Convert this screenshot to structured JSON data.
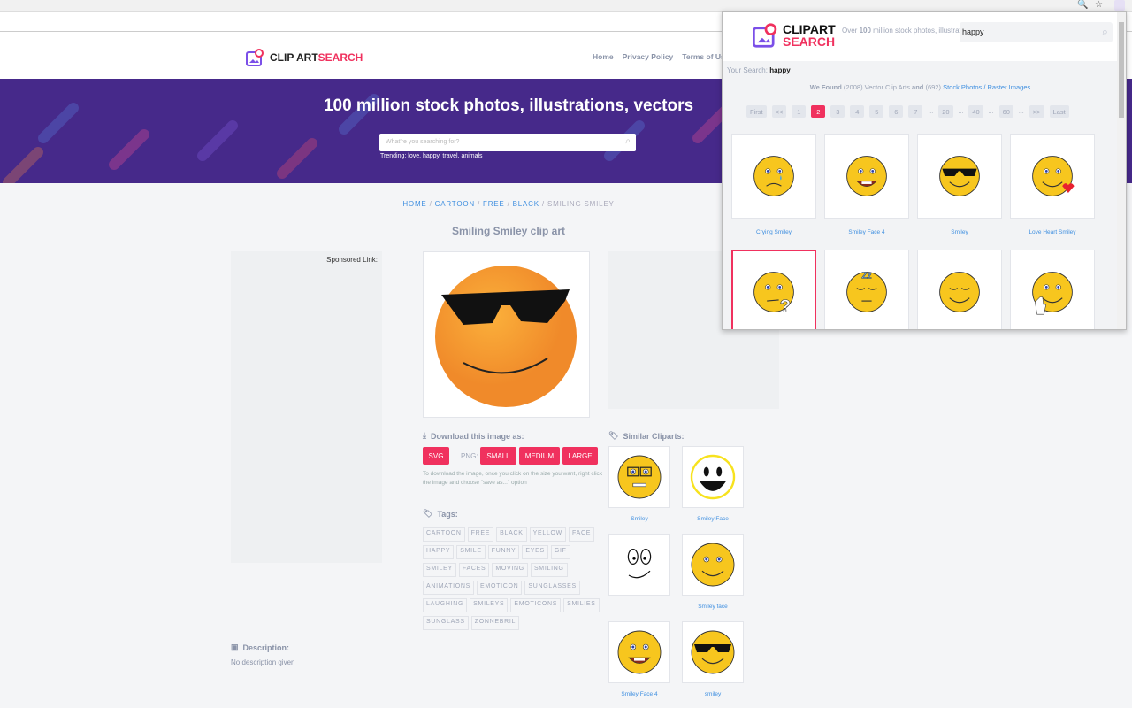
{
  "browser": {
    "icons": [
      "zoom-icon",
      "star-icon",
      "extension-icon"
    ]
  },
  "site": {
    "logo": {
      "a": "CLIP ART ",
      "b": "SEARCH"
    },
    "nav": [
      "Home",
      "Privacy Policy",
      "Terms of Use"
    ],
    "banner": {
      "headline": "100 million stock photos, illustrations, vectors",
      "search_placeholder": "What're you searching for?",
      "trending": "Trending: love, happy, travel, animals"
    },
    "breadcrumb": {
      "items": [
        "HOME",
        "CARTOON",
        "FREE",
        "BLACK"
      ],
      "current": "SMILING SMILEY",
      "sep": " / "
    },
    "title": "Smiling Smiley clip art",
    "sponsored": "Sponsored Link:",
    "download": {
      "heading": "Download this image as:",
      "svg": "SVG",
      "png_label": "PNG:",
      "small": "SMALL",
      "medium": "MEDIUM",
      "large": "LARGE",
      "note": "To download the image, once you click on the size you want, right click the image and choose \"save as...\" option"
    },
    "tags": {
      "heading": "Tags:",
      "items": [
        "CARTOON",
        "FREE",
        "BLACK",
        "YELLOW",
        "FACE",
        "HAPPY",
        "SMILE",
        "FUNNY",
        "EYES",
        "GIF",
        "SMILEY",
        "FACES",
        "MOVING",
        "SMILING",
        "ANIMATIONS",
        "EMOTICON",
        "SUNGLASSES",
        "LAUGHING",
        "SMILEYS",
        "EMOTICONS",
        "SMILIES",
        "SUNGLASS",
        "ZONNEBRIL"
      ]
    },
    "similar": {
      "heading": "Similar Cliparts:",
      "items": [
        {
          "label": "Smiley",
          "type": "glasses"
        },
        {
          "label": "Smiley Face",
          "type": "ghost"
        },
        {
          "label": "",
          "type": "outline"
        },
        {
          "label": "Smiley face",
          "type": "smile"
        },
        {
          "label": "Smiley Face 4",
          "type": "teeth"
        },
        {
          "label": "smiley",
          "type": "shades"
        }
      ]
    },
    "description": {
      "heading": "Description:",
      "text": "No description given"
    }
  },
  "popup": {
    "logo": {
      "a": "CLIPART",
      "b": "SEARCH"
    },
    "tagline": {
      "pre": "Over ",
      "bold": "100",
      "post": " million stock photos, illustrations, vectors"
    },
    "search_value": "happy",
    "your_search_label": "Your Search: ",
    "your_search": "happy",
    "found": {
      "a": "We Found",
      "b": " (2008) Vector Clip Arts ",
      "c": "and",
      "d": " (692) ",
      "link": "Stock Photos / Raster Images"
    },
    "pages": [
      "First",
      "<<",
      "1",
      "2",
      "3",
      "4",
      "5",
      "6",
      "7",
      "...",
      "20",
      "...",
      "40",
      "...",
      "60",
      "...",
      ">>",
      "Last"
    ],
    "current_page": "2",
    "results": [
      {
        "label": "Crying Smiley",
        "type": "cry"
      },
      {
        "label": "Smiley Face 4",
        "type": "teeth"
      },
      {
        "label": "Smiley",
        "type": "shades"
      },
      {
        "label": "Love Heart Smiley",
        "type": "heart"
      },
      {
        "label": "",
        "type": "question",
        "selected": true
      },
      {
        "label": "",
        "type": "sleep"
      },
      {
        "label": "",
        "type": "content"
      },
      {
        "label": "",
        "type": "wave"
      }
    ]
  },
  "colors": {
    "accent": "#f0315e",
    "banner": "#46298a",
    "link": "#3f8fe0"
  }
}
